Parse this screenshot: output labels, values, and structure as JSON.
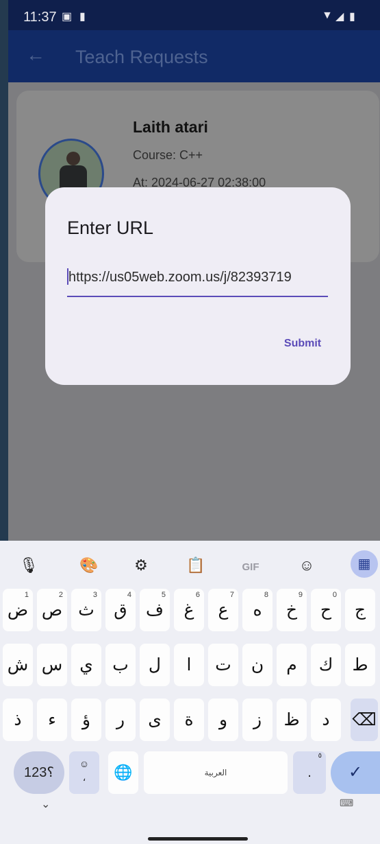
{
  "status_bar": {
    "time": "11:37"
  },
  "app_bar": {
    "back_icon": "arrow-left-icon",
    "title": "Teach Requests"
  },
  "request_card": {
    "name": "Laith atari",
    "course": "Course: C++",
    "at": "At: 2024-06-27 02:38:00"
  },
  "dialog": {
    "title": "Enter URL",
    "url_value": "https://us05web.zoom.us/j/82393719",
    "submit_label": "Submit"
  },
  "keyboard": {
    "toolbar": [
      "mic-icon",
      "palette-icon",
      "settings-icon",
      "clipboard-icon",
      "GIF",
      "sticker-icon",
      "grid-icon"
    ],
    "row1": [
      {
        "char": "ض",
        "hint": "1"
      },
      {
        "char": "ص",
        "hint": "2"
      },
      {
        "char": "ث",
        "hint": "3"
      },
      {
        "char": "ق",
        "hint": "4"
      },
      {
        "char": "ف",
        "hint": "5"
      },
      {
        "char": "غ",
        "hint": "6"
      },
      {
        "char": "ع",
        "hint": "7"
      },
      {
        "char": "ه",
        "hint": "8"
      },
      {
        "char": "خ",
        "hint": "9"
      },
      {
        "char": "ح",
        "hint": "0"
      },
      {
        "char": "ج",
        "hint": ""
      }
    ],
    "row2": [
      "ش",
      "س",
      "ي",
      "ب",
      "ل",
      "ا",
      "ت",
      "ن",
      "م",
      "ك",
      "ط"
    ],
    "row3": [
      "ذ",
      "ء",
      "ؤ",
      "ر",
      "ى",
      "ة",
      "و",
      "ز",
      "ظ",
      "د"
    ],
    "symbols_key": "؟123",
    "space_label": "العربية",
    "period_key": ".",
    "period_hint": "٥"
  }
}
